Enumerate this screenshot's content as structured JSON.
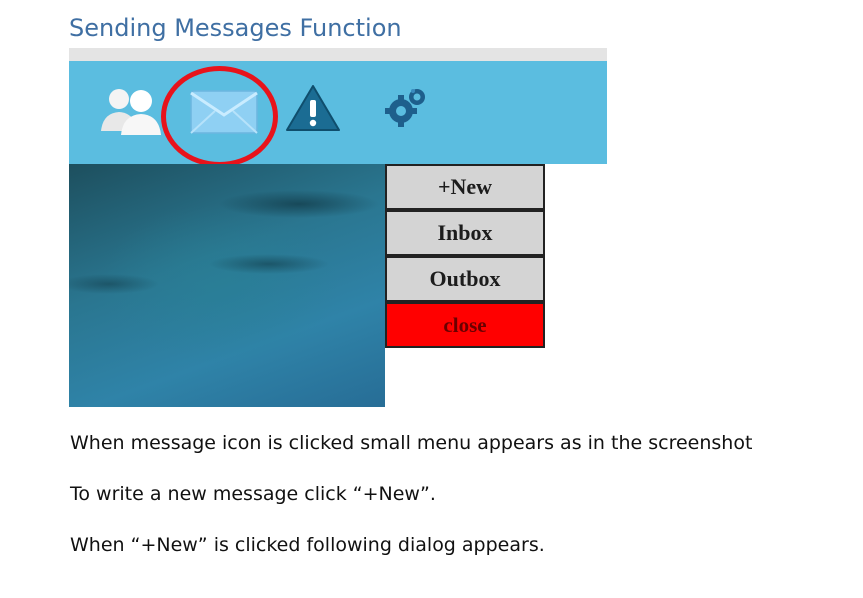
{
  "heading": "Sending Messages Function",
  "toolbar": {
    "icons": [
      "users-icon",
      "mail-icon",
      "warning-icon",
      "gear-icon"
    ],
    "background_color": "#5bbde0",
    "highlight_color": "#e8131b"
  },
  "menu": {
    "new_label": "+New",
    "inbox_label": "Inbox",
    "outbox_label": "Outbox",
    "close_label": "close",
    "close_color": "#ff0000"
  },
  "paragraphs": [
    "When message icon is clicked small menu appears as in the screenshot",
    "To write a new message click “+New”.",
    "When “+New” is clicked following dialog appears."
  ]
}
